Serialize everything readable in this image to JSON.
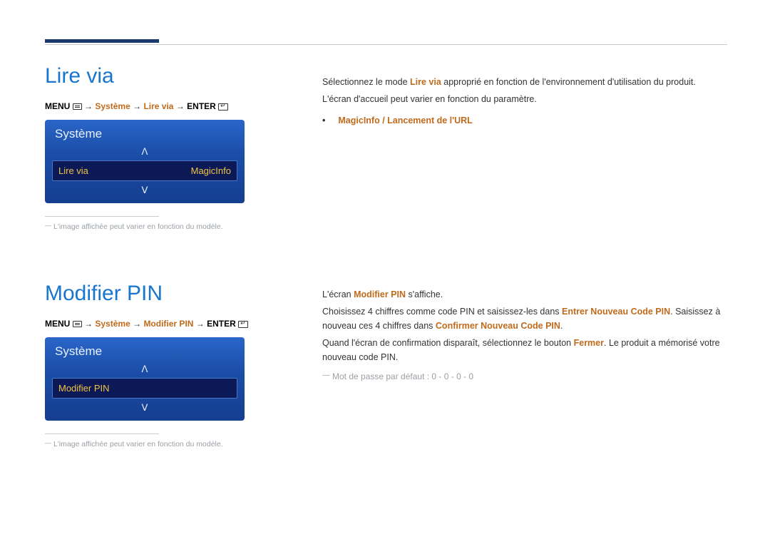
{
  "section1": {
    "title": "Lire via",
    "breadcrumb": {
      "menu": "MENU",
      "p1": "Système",
      "p2": "Lire via",
      "enter": "ENTER"
    },
    "osd": {
      "title": "Système",
      "row_label": "Lire via",
      "row_value": "MagicInfo"
    },
    "footnote": "L'image affichée peut varier en fonction du modèle.",
    "right": {
      "l1a": "Sélectionnez le mode ",
      "l1b": "Lire via",
      "l1c": " approprié en fonction de l'environnement d'utilisation du produit.",
      "l2": "L'écran d'accueil peut varier en fonction du paramètre.",
      "bullet": "MagicInfo / Lancement de l'URL"
    }
  },
  "section2": {
    "title": "Modifier PIN",
    "breadcrumb": {
      "menu": "MENU",
      "p1": "Système",
      "p2": "Modifier PIN",
      "enter": "ENTER"
    },
    "osd": {
      "title": "Système",
      "row_label": "Modifier PIN"
    },
    "footnote": "L'image affichée peut varier en fonction du modèle.",
    "right": {
      "l1a": "L'écran ",
      "l1b": "Modifier PIN",
      "l1c": " s'affiche.",
      "l2a": "Choisissez 4 chiffres comme code PIN et saisissez-les dans ",
      "l2b": "Entrer Nouveau Code PIN",
      "l2c": ". Saisissez à nouveau ces 4 chiffres dans ",
      "l2d": "Confirmer Nouveau Code PIN",
      "l2e": ".",
      "l3a": "Quand l'écran de confirmation disparaît, sélectionnez le bouton ",
      "l3b": "Fermer",
      "l3c": ". Le produit a mémorisé votre nouveau code PIN.",
      "note": "Mot de passe par défaut : 0 - 0 - 0 - 0"
    }
  },
  "glyphs": {
    "up": "ᐱ",
    "down": "ᐯ",
    "arrow": "→",
    "dot": "•"
  }
}
